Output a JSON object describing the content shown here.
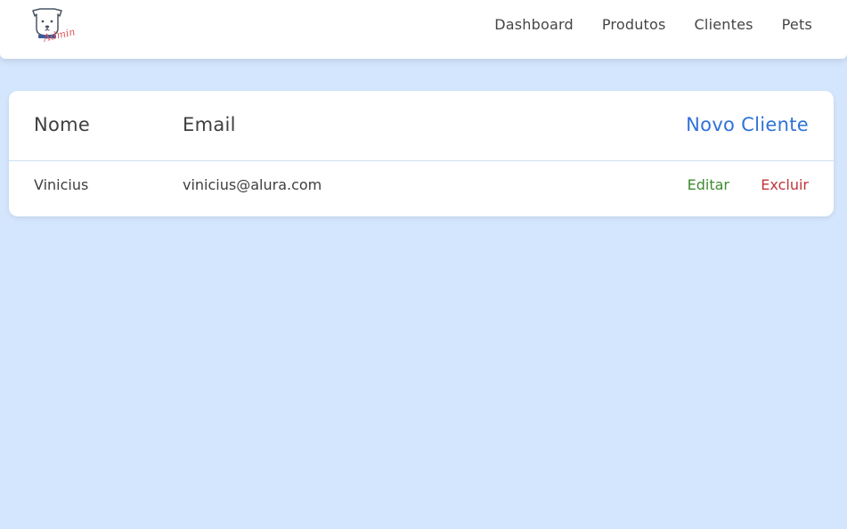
{
  "header": {
    "logo_alt": "PetShop Admin",
    "nav": [
      "Dashboard",
      "Produtos",
      "Clientes",
      "Pets"
    ]
  },
  "table": {
    "columns": {
      "nome": "Nome",
      "email": "Email"
    },
    "new_button": "Novo Cliente",
    "rows": [
      {
        "nome": "Vinicius",
        "email": "vinicius@alura.com",
        "edit_label": "Editar",
        "delete_label": "Excluir"
      }
    ]
  },
  "colors": {
    "background": "#d4e6fd",
    "link_blue": "#2f73d8",
    "edit_green": "#3d8b2f",
    "delete_red": "#c0353b"
  }
}
